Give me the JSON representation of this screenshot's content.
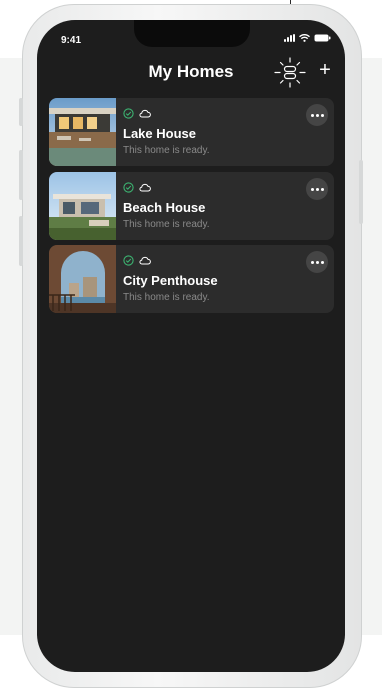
{
  "status_bar": {
    "time": "9:41"
  },
  "header": {
    "title": "My Homes",
    "add_label": "+"
  },
  "homes": [
    {
      "name": "Lake House",
      "status": "This home is ready.",
      "image": "lake-house-photo"
    },
    {
      "name": "Beach House",
      "status": "This home is ready.",
      "image": "beach-house-photo"
    },
    {
      "name": "City Penthouse",
      "status": "This home is ready.",
      "image": "city-penthouse-photo"
    }
  ],
  "colors": {
    "screen_bg": "#1d1d1d",
    "card_bg": "#2c2c2c",
    "ready_green": "#3cb371",
    "muted_text": "#8a8a8a"
  },
  "icons": {
    "header": "hub-device-icon",
    "ready": "check-circle-icon",
    "cloud": "cloud-icon",
    "more": "more-horizontal-icon"
  }
}
